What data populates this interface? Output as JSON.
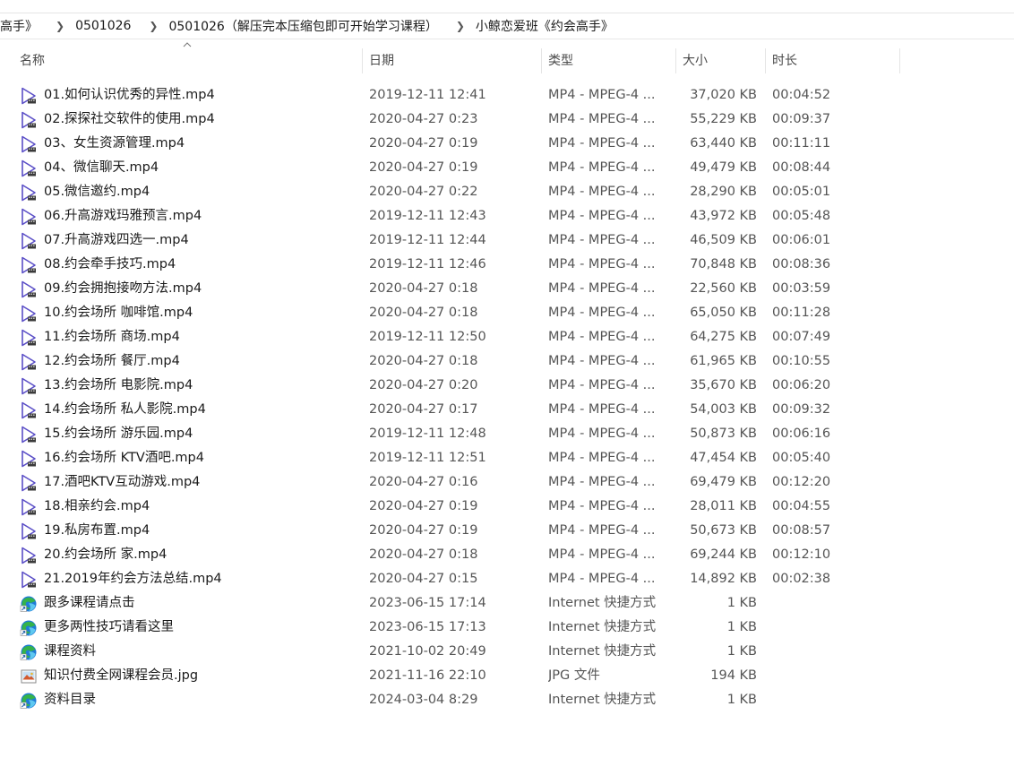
{
  "breadcrumb": [
    "高手》",
    "0501026",
    "0501026（解压完本压缩包即可开始学习课程）",
    "小鲸恋爱班《约会高手》"
  ],
  "columns": {
    "name": "名称",
    "date": "日期",
    "type": "类型",
    "size": "大小",
    "duration": "时长"
  },
  "colors": {
    "video_icon": "#5b4fc7",
    "edge_blue": "#1f7bd6",
    "edge_green": "#35b34a"
  },
  "files": [
    {
      "name": "01.如何认识优秀的异性.mp4",
      "date": "2019-12-11 12:41",
      "type": "MP4 - MPEG-4 ...",
      "size": "37,020 KB",
      "duration": "00:04:52",
      "icon": "video-file-icon"
    },
    {
      "name": "02.探探社交软件的使用.mp4",
      "date": "2020-04-27 0:23",
      "type": "MP4 - MPEG-4 ...",
      "size": "55,229 KB",
      "duration": "00:09:37",
      "icon": "video-file-icon"
    },
    {
      "name": "03、女生资源管理.mp4",
      "date": "2020-04-27 0:19",
      "type": "MP4 - MPEG-4 ...",
      "size": "63,440 KB",
      "duration": "00:11:11",
      "icon": "video-file-icon"
    },
    {
      "name": "04、微信聊天.mp4",
      "date": "2020-04-27 0:19",
      "type": "MP4 - MPEG-4 ...",
      "size": "49,479 KB",
      "duration": "00:08:44",
      "icon": "video-file-icon"
    },
    {
      "name": "05.微信邀约.mp4",
      "date": "2020-04-27 0:22",
      "type": "MP4 - MPEG-4 ...",
      "size": "28,290 KB",
      "duration": "00:05:01",
      "icon": "video-file-icon"
    },
    {
      "name": "06.升高游戏玛雅预言.mp4",
      "date": "2019-12-11 12:43",
      "type": "MP4 - MPEG-4 ...",
      "size": "43,972 KB",
      "duration": "00:05:48",
      "icon": "video-file-icon"
    },
    {
      "name": "07.升高游戏四选一.mp4",
      "date": "2019-12-11 12:44",
      "type": "MP4 - MPEG-4 ...",
      "size": "46,509 KB",
      "duration": "00:06:01",
      "icon": "video-file-icon"
    },
    {
      "name": "08.约会牵手技巧.mp4",
      "date": "2019-12-11 12:46",
      "type": "MP4 - MPEG-4 ...",
      "size": "70,848 KB",
      "duration": "00:08:36",
      "icon": "video-file-icon"
    },
    {
      "name": "09.约会拥抱接吻方法.mp4",
      "date": "2020-04-27 0:18",
      "type": "MP4 - MPEG-4 ...",
      "size": "22,560 KB",
      "duration": "00:03:59",
      "icon": "video-file-icon"
    },
    {
      "name": "10.约会场所 咖啡馆.mp4",
      "date": "2020-04-27 0:18",
      "type": "MP4 - MPEG-4 ...",
      "size": "65,050 KB",
      "duration": "00:11:28",
      "icon": "video-file-icon"
    },
    {
      "name": "11.约会场所 商场.mp4",
      "date": "2019-12-11 12:50",
      "type": "MP4 - MPEG-4 ...",
      "size": "64,275 KB",
      "duration": "00:07:49",
      "icon": "video-file-icon"
    },
    {
      "name": "12.约会场所 餐厅.mp4",
      "date": "2020-04-27 0:18",
      "type": "MP4 - MPEG-4 ...",
      "size": "61,965 KB",
      "duration": "00:10:55",
      "icon": "video-file-icon"
    },
    {
      "name": "13.约会场所 电影院.mp4",
      "date": "2020-04-27 0:20",
      "type": "MP4 - MPEG-4 ...",
      "size": "35,670 KB",
      "duration": "00:06:20",
      "icon": "video-file-icon"
    },
    {
      "name": "14.约会场所 私人影院.mp4",
      "date": "2020-04-27 0:17",
      "type": "MP4 - MPEG-4 ...",
      "size": "54,003 KB",
      "duration": "00:09:32",
      "icon": "video-file-icon"
    },
    {
      "name": "15.约会场所 游乐园.mp4",
      "date": "2019-12-11 12:48",
      "type": "MP4 - MPEG-4 ...",
      "size": "50,873 KB",
      "duration": "00:06:16",
      "icon": "video-file-icon"
    },
    {
      "name": "16.约会场所 KTV酒吧.mp4",
      "date": "2019-12-11 12:51",
      "type": "MP4 - MPEG-4 ...",
      "size": "47,454 KB",
      "duration": "00:05:40",
      "icon": "video-file-icon"
    },
    {
      "name": "17.酒吧KTV互动游戏.mp4",
      "date": "2020-04-27 0:16",
      "type": "MP4 - MPEG-4 ...",
      "size": "69,479 KB",
      "duration": "00:12:20",
      "icon": "video-file-icon"
    },
    {
      "name": "18.相亲约会.mp4",
      "date": "2020-04-27 0:19",
      "type": "MP4 - MPEG-4 ...",
      "size": "28,011 KB",
      "duration": "00:04:55",
      "icon": "video-file-icon"
    },
    {
      "name": "19.私房布置.mp4",
      "date": "2020-04-27 0:19",
      "type": "MP4 - MPEG-4 ...",
      "size": "50,673 KB",
      "duration": "00:08:57",
      "icon": "video-file-icon"
    },
    {
      "name": "20.约会场所 家.mp4",
      "date": "2020-04-27 0:18",
      "type": "MP4 - MPEG-4 ...",
      "size": "69,244 KB",
      "duration": "00:12:10",
      "icon": "video-file-icon"
    },
    {
      "name": "21.2019年约会方法总结.mp4",
      "date": "2020-04-27 0:15",
      "type": "MP4 - MPEG-4 ...",
      "size": "14,892 KB",
      "duration": "00:02:38",
      "icon": "video-file-icon"
    },
    {
      "name": "跟多课程请点击",
      "date": "2023-06-15 17:14",
      "type": "Internet 快捷方式",
      "size": "1 KB",
      "duration": "",
      "icon": "internet-shortcut-icon"
    },
    {
      "name": "更多两性技巧请看这里",
      "date": "2023-06-15 17:13",
      "type": "Internet 快捷方式",
      "size": "1 KB",
      "duration": "",
      "icon": "internet-shortcut-icon"
    },
    {
      "name": "课程资料",
      "date": "2021-10-02 20:49",
      "type": "Internet 快捷方式",
      "size": "1 KB",
      "duration": "",
      "icon": "internet-shortcut-icon"
    },
    {
      "name": "知识付费全网课程会员.jpg",
      "date": "2021-11-16 22:10",
      "type": "JPG 文件",
      "size": "194 KB",
      "duration": "",
      "icon": "image-file-icon"
    },
    {
      "name": "资料目录",
      "date": "2024-03-04 8:29",
      "type": "Internet 快捷方式",
      "size": "1 KB",
      "duration": "",
      "icon": "internet-shortcut-icon"
    }
  ]
}
